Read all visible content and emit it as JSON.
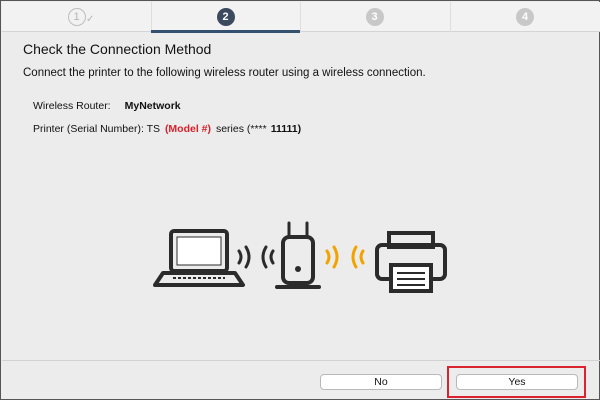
{
  "steps": [
    {
      "label": "1",
      "state": "done"
    },
    {
      "label": "2",
      "state": "active"
    },
    {
      "label": "3",
      "state": "pending"
    },
    {
      "label": "4",
      "state": "pending"
    }
  ],
  "dialog": {
    "title": "Check the Connection Method",
    "description": "Connect the printer to the following wireless router using a wireless connection.",
    "router_label": "Wireless Router:",
    "router_value": "MyNetwork",
    "printer_label": "Printer (Serial Number): TS",
    "printer_model": "(Model #)",
    "printer_series": "series (****",
    "printer_serial": "11111)"
  },
  "buttons": {
    "no_label": "No",
    "yes_label": "Yes"
  },
  "colors": {
    "active_step": "#3b4a5e",
    "model_text": "#d8202b",
    "wave_orange": "#f2a300",
    "highlight": "#d9232e"
  },
  "icons": [
    "laptop-icon",
    "wifi-waves-icon",
    "router-icon",
    "printer-icon",
    "check-icon"
  ]
}
